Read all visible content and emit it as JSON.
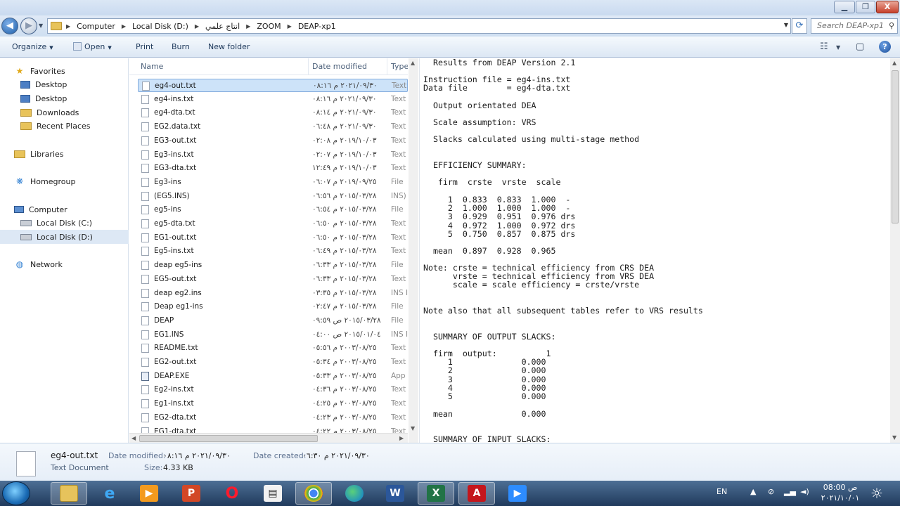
{
  "window": {
    "minimize_label": "▁",
    "maximize_label": "❐",
    "close_label": "X"
  },
  "address": {
    "crumbs": [
      "Computer",
      "Local Disk (D:)",
      "انتاج علمي",
      "ZOOM",
      "DEAP-xp1"
    ],
    "search_placeholder": "Search DEAP-xp1"
  },
  "toolbar": {
    "organize": "Organize",
    "open": "Open",
    "print": "Print",
    "burn": "Burn",
    "new_folder": "New folder"
  },
  "nav": {
    "favorites": "Favorites",
    "desktop1": "Desktop",
    "desktop2": "Desktop",
    "downloads": "Downloads",
    "recent": "Recent Places",
    "libraries": "Libraries",
    "homegroup": "Homegroup",
    "computer": "Computer",
    "local_c": "Local Disk (C:)",
    "local_d": "Local Disk (D:)",
    "network": "Network"
  },
  "columns": {
    "name": "Name",
    "date": "Date modified",
    "type": "Type"
  },
  "files": [
    {
      "name": "eg4-out.txt",
      "date": "٢٠٢١/٠٩/٣٠ م ٠٨:١٦",
      "type": "Text"
    },
    {
      "name": "eg4-ins.txt",
      "date": "٢٠٢١/٠٩/٣٠ م ٠٨:١٦",
      "type": "Text"
    },
    {
      "name": "eg4-dta.txt",
      "date": "٢٠٢١/٠٩/٣٠ م ٠٨:١٤",
      "type": "Text"
    },
    {
      "name": "EG2.data.txt",
      "date": "٢٠٢١/٠٩/٣٠ م ٠٦:٤٨",
      "type": "Text"
    },
    {
      "name": "EG3-out.txt",
      "date": "٢٠١٩/١٠/٠٣ م ٠٢:٠٨",
      "type": "Text"
    },
    {
      "name": "Eg3-ins.txt",
      "date": "٢٠١٩/١٠/٠٣ م ٠٢:٠٧",
      "type": "Text"
    },
    {
      "name": "EG3-dta.txt",
      "date": "٢٠١٩/١٠/٠٣ م ١٢:٤٩",
      "type": "Text"
    },
    {
      "name": "Eg3-ins",
      "date": "٢٠١٩/٠٩/٢٥ م ٠٦:٠٧",
      "type": "File"
    },
    {
      "name": "(EG5.INS)",
      "date": "٢٠١٥/٠٣/٢٨ م ٠٦:٥٦",
      "type": "INS)"
    },
    {
      "name": "eg5-ins",
      "date": "٢٠١٥/٠٣/٢٨ م ٠٦:٥٤",
      "type": "File"
    },
    {
      "name": "eg5-dta.txt",
      "date": "٢٠١٥/٠٣/٢٨ م ٠٦:٥٠",
      "type": "Text"
    },
    {
      "name": "EG1-out.txt",
      "date": "٢٠١٥/٠٣/٢٨ م ٠٦:٥٠",
      "type": "Text"
    },
    {
      "name": "Eg5-ins.txt",
      "date": "٢٠١٥/٠٣/٢٨ م ٠٦:٤٩",
      "type": "Text"
    },
    {
      "name": "deap eg5-ins",
      "date": "٢٠١٥/٠٣/٢٨ م ٠٦:٣٣",
      "type": "File"
    },
    {
      "name": "EG5-out.txt",
      "date": "٢٠١٥/٠٣/٢٨ م ٠٦:٣٣",
      "type": "Text"
    },
    {
      "name": "deap eg2.ins",
      "date": "٢٠١٥/٠٣/٢٨ م ٠٣:٣٥",
      "type": "INS I"
    },
    {
      "name": "Deap eg1-ins",
      "date": "٢٠١٥/٠٣/٢٨ م ٠٢:٤٧",
      "type": "File"
    },
    {
      "name": "DEAP",
      "date": "٢٠١٥/٠٣/٢٨ ص ٠٩:٥٩",
      "type": "File"
    },
    {
      "name": "EG1.INS",
      "date": "٢٠١٥/٠١/٠٤ ص ٠٤:٠٠",
      "type": "INS I"
    },
    {
      "name": "README.txt",
      "date": "٢٠٠٣/٠٨/٢٥ م ٠٥:٥٦",
      "type": "Text"
    },
    {
      "name": "EG2-out.txt",
      "date": "٢٠٠٣/٠٨/٢٥ م ٠٥:٣٤",
      "type": "Text"
    },
    {
      "name": "DEAP.EXE",
      "date": "٢٠٠٣/٠٨/٢٥ م ٠٥:٣٣",
      "type": "App"
    },
    {
      "name": "Eg2-ins.txt",
      "date": "٢٠٠٣/٠٨/٢٥ م ٠٤:٣٦",
      "type": "Text"
    },
    {
      "name": "Eg1-ins.txt",
      "date": "٢٠٠٣/٠٨/٢٥ م ٠٤:٢٥",
      "type": "Text"
    },
    {
      "name": "EG2-dta.txt",
      "date": "٢٠٠٣/٠٨/٢٥ م ٠٤:٢٣",
      "type": "Text"
    },
    {
      "name": "EG1-dta.txt",
      "date": "٢٠٠٣/٠٨/٢٥ م ٠٤:٢٢",
      "type": "Text"
    }
  ],
  "preview": {
    "p1": "  Results from DEAP Version 2.1",
    "p2": "Instruction file = eg4-ins.txt\nData file        = eg4-dta.txt",
    "p3": "  Output orientated DEA",
    "p4": "  Scale assumption: VRS",
    "p5": "  Slacks calculated using multi-stage method",
    "p6": "  EFFICIENCY SUMMARY:",
    "p7": "   firm  crste  vrste  scale",
    "p8": "     1  0.833  0.833  1.000  -\n     2  1.000  1.000  1.000  -\n     3  0.929  0.951  0.976 drs\n     4  0.972  1.000  0.972 drs\n     5  0.750  0.857  0.875 drs",
    "p9": "  mean  0.897  0.928  0.965",
    "p10": "Note: crste = technical efficiency from CRS DEA\n      vrste = technical efficiency from VRS DEA\n      scale = scale efficiency = crste/vrste",
    "p11": "Note also that all subsequent tables refer to VRS results",
    "p12": "  SUMMARY OF OUTPUT SLACKS:",
    "p13": "  firm  output:          1\n     1              0.000\n     2              0.000\n     3              0.000\n     4              0.000\n     5              0.000",
    "p14": "  mean              0.000",
    "p15": "  SUMMARY OF INPUT SLACKS:"
  },
  "details": {
    "name": "eg4-out.txt",
    "type": "Text Document",
    "modified_label": "Date modified:",
    "modified_value": "٢٠٢١/٠٩/٣٠ م ٠٨:١٦",
    "created_label": "Date created:",
    "created_value": "٢٠٢١/٠٩/٣٠ م ٠٦:٣٠",
    "size_label": "Size:",
    "size_value": "4.33 KB"
  },
  "taskbar": {
    "lang": "EN",
    "time": "ص 08:00",
    "date": "٢٠٢١/١٠/٠١"
  }
}
